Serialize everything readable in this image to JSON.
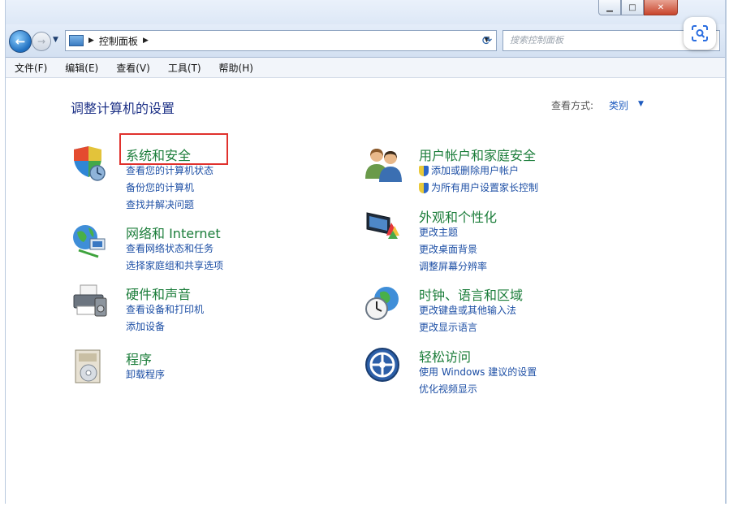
{
  "navigation": {
    "address_path": "控制面板",
    "search_placeholder": "搜索控制面板"
  },
  "menubar": {
    "items": [
      "文件(F)",
      "编辑(E)",
      "查看(V)",
      "工具(T)",
      "帮助(H)"
    ]
  },
  "page": {
    "title": "调整计算机的设置",
    "view_by_label": "查看方式:",
    "view_by_value": "类别"
  },
  "categories": [
    {
      "title": "系统和安全",
      "icon": "shield-icon",
      "links": [
        "查看您的计算机状态",
        "备份您的计算机",
        "查找并解决问题"
      ]
    },
    {
      "title": "网络和 Internet",
      "icon": "network-globe-icon",
      "links": [
        "查看网络状态和任务",
        "选择家庭组和共享选项"
      ]
    },
    {
      "title": "硬件和声音",
      "icon": "printer-icon",
      "links": [
        "查看设备和打印机",
        "添加设备"
      ]
    },
    {
      "title": "程序",
      "icon": "programs-icon",
      "links": [
        "卸载程序"
      ]
    },
    {
      "title": "用户帐户和家庭安全",
      "icon": "users-icon",
      "links": [
        "添加或删除用户帐户",
        "为所有用户设置家长控制"
      ]
    },
    {
      "title": "外观和个性化",
      "icon": "monitor-paint-icon",
      "links": [
        "更改主题",
        "更改桌面背景",
        "调整屏幕分辨率"
      ]
    },
    {
      "title": "时钟、语言和区域",
      "icon": "clock-globe-icon",
      "links": [
        "更改键盘或其他输入法",
        "更改显示语言"
      ]
    },
    {
      "title": "轻松访问",
      "icon": "ease-of-access-icon",
      "links": [
        "使用 Windows 建议的设置",
        "优化视频显示"
      ]
    }
  ],
  "colors": {
    "category_title": "#1b7d3a",
    "link": "#1d4fa5",
    "page_title": "#1e3287",
    "highlight_box": "#e0312d"
  }
}
